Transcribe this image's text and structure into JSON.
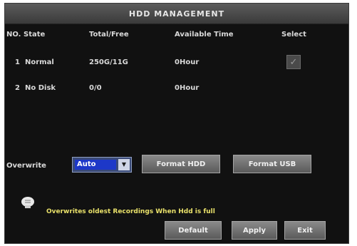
{
  "window": {
    "title": "HDD MANAGEMENT"
  },
  "table": {
    "headers": [
      "NO.",
      "State",
      "Total/Free",
      "Available Time",
      "Select"
    ],
    "rows": [
      {
        "no": "1",
        "state": "Normal",
        "total_free": "250G/11G",
        "available_time": "0Hour",
        "select_checked": true
      },
      {
        "no": "2",
        "state": "No Disk",
        "total_free": "0/0",
        "available_time": "0Hour",
        "select_checked": false
      }
    ]
  },
  "overwrite": {
    "label": "Overwrite",
    "selected": "Auto"
  },
  "buttons": {
    "format_hdd": "Format HDD",
    "format_usb": "Format USB",
    "default": "Default",
    "apply": "Apply",
    "exit": "Exit"
  },
  "tip": {
    "icon": "lightbulb-icon",
    "text": "Overwrites oldest Recordings When Hdd is full"
  },
  "colors": {
    "panel_bg": "#111111",
    "title_bar": "#4a4a4a",
    "select_highlight": "#1d38c8",
    "tip_text": "#e9e16a",
    "button": "#707070"
  }
}
